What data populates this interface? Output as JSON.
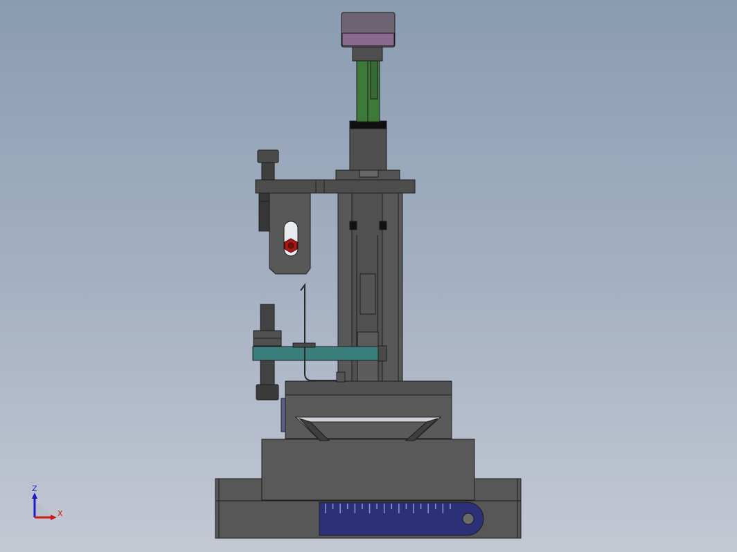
{
  "triad": {
    "z_label": "Z",
    "x_label": "X",
    "z_color": "#1a1acc",
    "x_color": "#cc1a1a"
  },
  "colors": {
    "steel_dark": "#4a4a4a",
    "steel_mid": "#5a5a5a",
    "steel_light": "#6a6a6a",
    "motor_cap": "#7a6a80",
    "motor_band": "#9a7aa2",
    "cylinder_green": "#3d7a3a",
    "guide_teal": "#3a7f7c",
    "scale_blue": "#2b2f78",
    "screw_red": "#b01515"
  },
  "scale": {
    "tick_count": 18
  }
}
